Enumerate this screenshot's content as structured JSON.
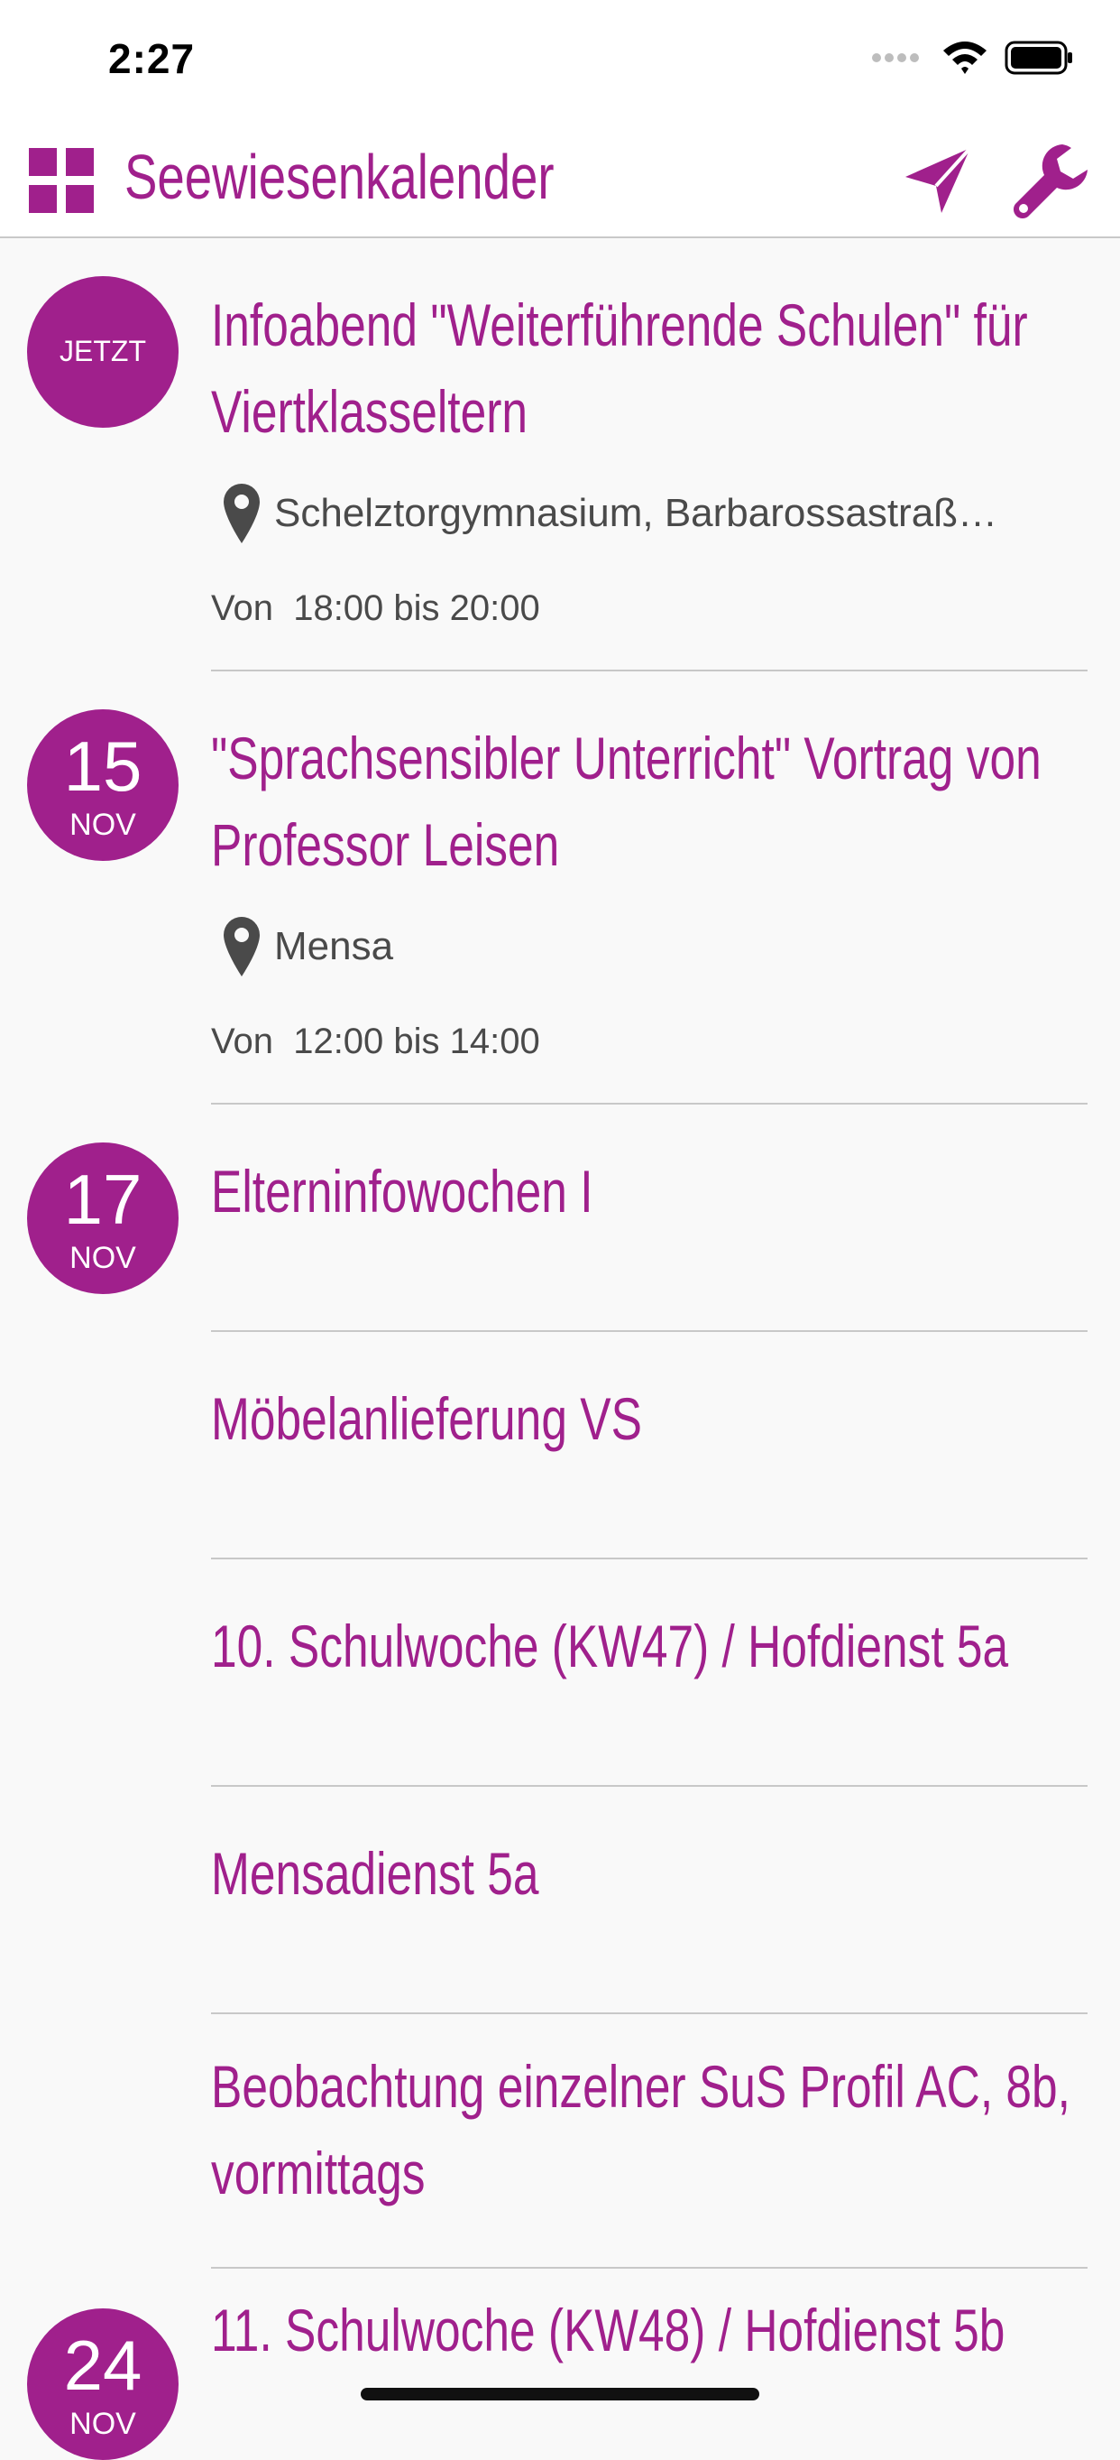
{
  "status": {
    "time": "2:27"
  },
  "app": {
    "title": "Seewiesenkalender"
  },
  "colors": {
    "accent": "#a0208c",
    "text_secondary": "#4a4a4a",
    "background": "#f9f9f9"
  },
  "icons": {
    "menu": "grid-icon",
    "send": "paper-plane-icon",
    "settings": "wrench-icon",
    "location": "location-pin-icon"
  },
  "events": [
    {
      "badge_label": "JETZT",
      "title": "Infoabend \"Weiterführende Schulen\" für Viertklasseltern",
      "location": "Schelztorgymnasium, Barbarossastraß…",
      "time_prefix": "Von",
      "time": "18:00 bis 20:00"
    },
    {
      "day": "15",
      "month": "NOV",
      "title": "\"Sprachsensibler Unterricht\" Vortrag von Professor Leisen",
      "location": "Mensa",
      "time_prefix": "Von",
      "time": "12:00 bis 14:00"
    },
    {
      "day": "17",
      "month": "NOV",
      "title": "Elterninfowochen I"
    },
    {
      "title": "Möbelanlieferung VS"
    },
    {
      "title": "10. Schulwoche (KW47) / Hofdienst 5a"
    },
    {
      "title": "Mensadienst 5a"
    },
    {
      "title": "Beobachtung einzelner SuS Profil AC, 8b, vormittags"
    },
    {
      "day": "24",
      "month": "NOV",
      "title": "11. Schulwoche (KW48) / Hofdienst 5b"
    }
  ]
}
